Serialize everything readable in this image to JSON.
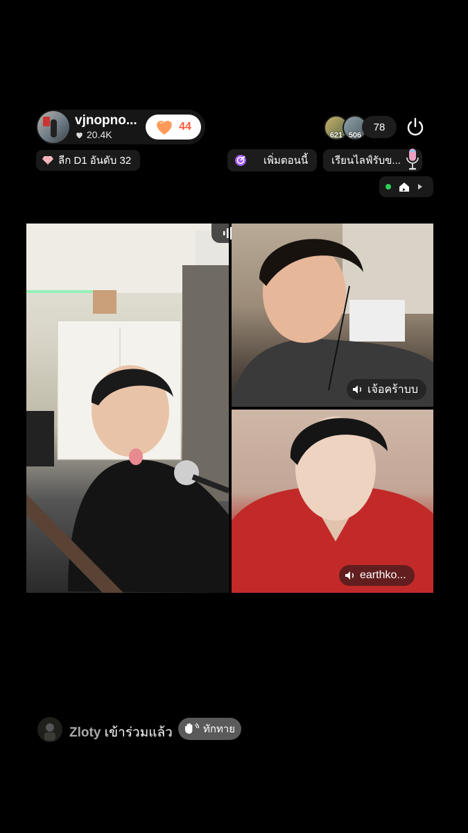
{
  "host": {
    "name": "vjnopno...",
    "likes": "20.4K",
    "gift_count": "44"
  },
  "viewers": {
    "avatar_1_count": "621",
    "avatar_2_count": "506",
    "total": "78"
  },
  "badges": {
    "league": "ลีก D1 อันดับ 32",
    "add_now": "เพิ่มตอนนี้",
    "learn_live": "เรียนไลฟ์รับข..."
  },
  "guests": {
    "top_name": "เจ้อคร้าบบ",
    "bottom_name": "earthko..."
  },
  "join_notice": {
    "username": "Zloty",
    "action": " เข้าร่วมแล้ว",
    "wave_label": "ทักทาย"
  },
  "colors": {
    "gift_accent": "#ff5a3c",
    "live_dot": "#2fd05a",
    "add_now_icon": "#a45cf2"
  },
  "icons": [
    "heart-icon",
    "gift-heart-icon",
    "power-icon",
    "diamond-icon",
    "target-icon",
    "microphone-icon",
    "home-icon",
    "play-icon",
    "audio-bars-icon",
    "speaker-icon",
    "wave-hand-icon"
  ]
}
